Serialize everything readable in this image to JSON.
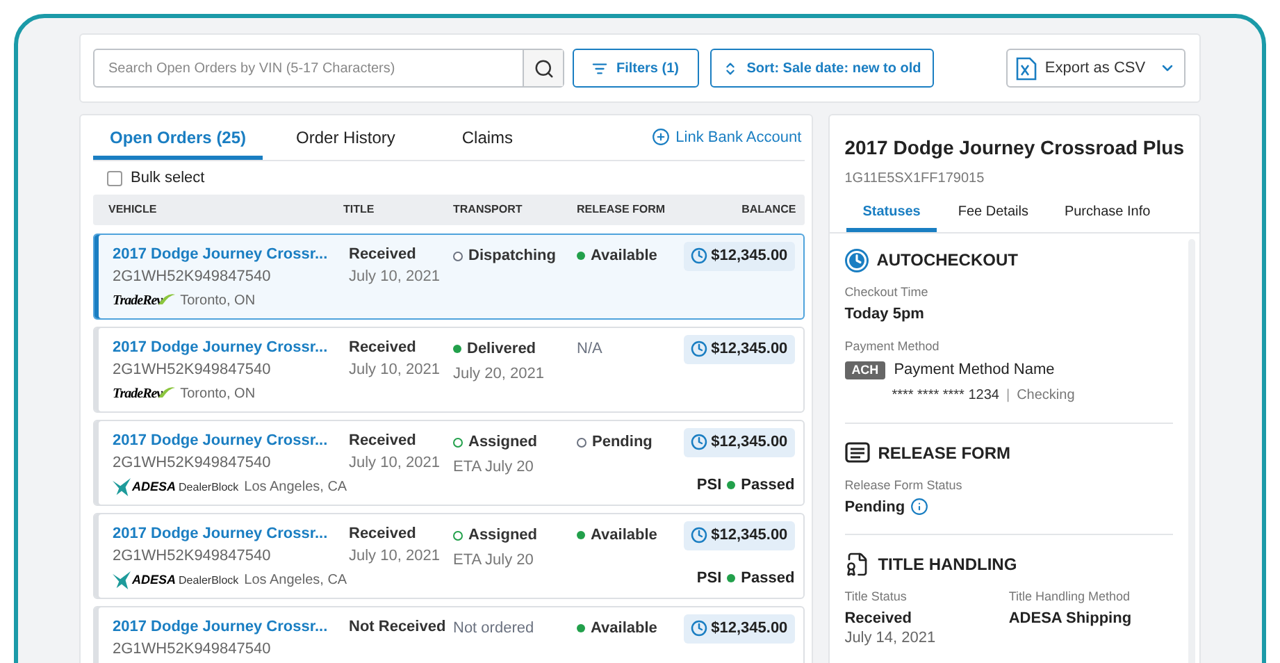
{
  "toolbar": {
    "search": {
      "placeholder": "Search Open Orders by VIN (5-17 Characters)"
    },
    "filters_button": "Filters (1)",
    "sort_button": "Sort: Sale date: new to old",
    "export_button": "Export as CSV"
  },
  "orders_panel": {
    "tabs": [
      {
        "label": "Open Orders (25)",
        "selected": true
      },
      {
        "label": "Order History",
        "selected": false
      },
      {
        "label": "Claims",
        "selected": false
      }
    ],
    "link_bank_account": "Link Bank Account",
    "bulk_select": {
      "label": "Bulk select",
      "checked": false
    },
    "columns": [
      "VEHICLE",
      "TITLE",
      "TRANSPORT",
      "RELEASE FORM",
      "BALANCE"
    ],
    "rows": [
      {
        "selected": true,
        "vehicle": "2017 Dodge Journey Crossr...",
        "vin": "2G1WH52K949847540",
        "seller": {
          "kind": "traderev",
          "name": "TradeRev"
        },
        "location": "Toronto, ON",
        "title": {
          "status": "Received",
          "date": "July 10, 2021"
        },
        "transport": {
          "status": "Dispatching",
          "kind": "hollow",
          "color": "#6b7280"
        },
        "release_form": {
          "status": "Available",
          "kind": "filled",
          "color": "#22a04b"
        },
        "balance": "$12,345.00"
      },
      {
        "selected": false,
        "vehicle": "2017 Dodge Journey Crossr...",
        "vin": "2G1WH52K949847540",
        "seller": {
          "kind": "traderev",
          "name": "TradeRev"
        },
        "location": "Toronto, ON",
        "title": {
          "status": "Received",
          "date": "July 10, 2021"
        },
        "transport": {
          "status": "Delivered",
          "kind": "filled",
          "color": "#22a04b",
          "detail": "July 20, 2021"
        },
        "release_form": {
          "status": "N/A",
          "kind": "plain"
        },
        "balance": "$12,345.00"
      },
      {
        "selected": false,
        "vehicle": "2017 Dodge Journey Crossr...",
        "vin": "2G1WH52K949847540",
        "seller": {
          "kind": "adesa",
          "name": "ADESA",
          "division": "DealerBlock"
        },
        "location": "Los Angeles, CA",
        "title": {
          "status": "Received",
          "date": "July 10, 2021"
        },
        "transport": {
          "status": "Assigned",
          "kind": "hollow",
          "color": "#22a04b",
          "detail": "ETA July 20"
        },
        "release_form": {
          "status": "Pending",
          "kind": "hollow",
          "color": "#6b7280"
        },
        "balance": "$12,345.00",
        "psi": {
          "label": "PSI",
          "status": "Passed",
          "color": "#22a04b"
        }
      },
      {
        "selected": false,
        "vehicle": "2017 Dodge Journey Crossr...",
        "vin": "2G1WH52K949847540",
        "seller": {
          "kind": "adesa",
          "name": "ADESA",
          "division": "DealerBlock"
        },
        "location": "Los Angeles, CA",
        "title": {
          "status": "Received",
          "date": "July 10, 2021"
        },
        "transport": {
          "status": "Assigned",
          "kind": "hollow",
          "color": "#22a04b",
          "detail": "ETA July 20"
        },
        "release_form": {
          "status": "Available",
          "kind": "filled",
          "color": "#22a04b"
        },
        "balance": "$12,345.00",
        "psi": {
          "label": "PSI",
          "status": "Passed",
          "color": "#22a04b"
        }
      },
      {
        "selected": false,
        "vehicle": "2017 Dodge Journey Crossr...",
        "vin": "2G1WH52K949847540",
        "title": {
          "status": "Not Received"
        },
        "transport": {
          "status": "Not ordered",
          "kind": "plain"
        },
        "release_form": {
          "status": "Available",
          "kind": "filled",
          "color": "#22a04b"
        },
        "balance": "$12,345.00"
      }
    ]
  },
  "detail_panel": {
    "title": "2017 Dodge Journey Crossroad Plus",
    "vin": "1G11E5SX1FF179015",
    "tabs": [
      {
        "label": "Statuses",
        "selected": true
      },
      {
        "label": "Fee Details",
        "selected": false
      },
      {
        "label": "Purchase Info",
        "selected": false
      }
    ],
    "sections": [
      {
        "kind": "autocheckout",
        "heading": "AUTOCHECKOUT",
        "fields": [
          {
            "label": "Checkout Time",
            "value": "Today 5pm"
          },
          {
            "label": "Payment Method",
            "badge": "ACH",
            "value": "Payment Method Name",
            "account": "**** **** **** 1234",
            "separator": "|",
            "account_type": "Checking"
          }
        ]
      },
      {
        "kind": "release_form",
        "heading": "RELEASE FORM",
        "fields": [
          {
            "label": "Release Form Status",
            "value": "Pending",
            "info": true
          }
        ]
      },
      {
        "kind": "title_handling",
        "heading": "TITLE HANDLING",
        "fields": [
          {
            "label": "Title Status",
            "value": "Received",
            "date": "July 14, 2021"
          },
          {
            "label": "Title Handling Method",
            "value": "ADESA Shipping"
          }
        ]
      }
    ]
  }
}
